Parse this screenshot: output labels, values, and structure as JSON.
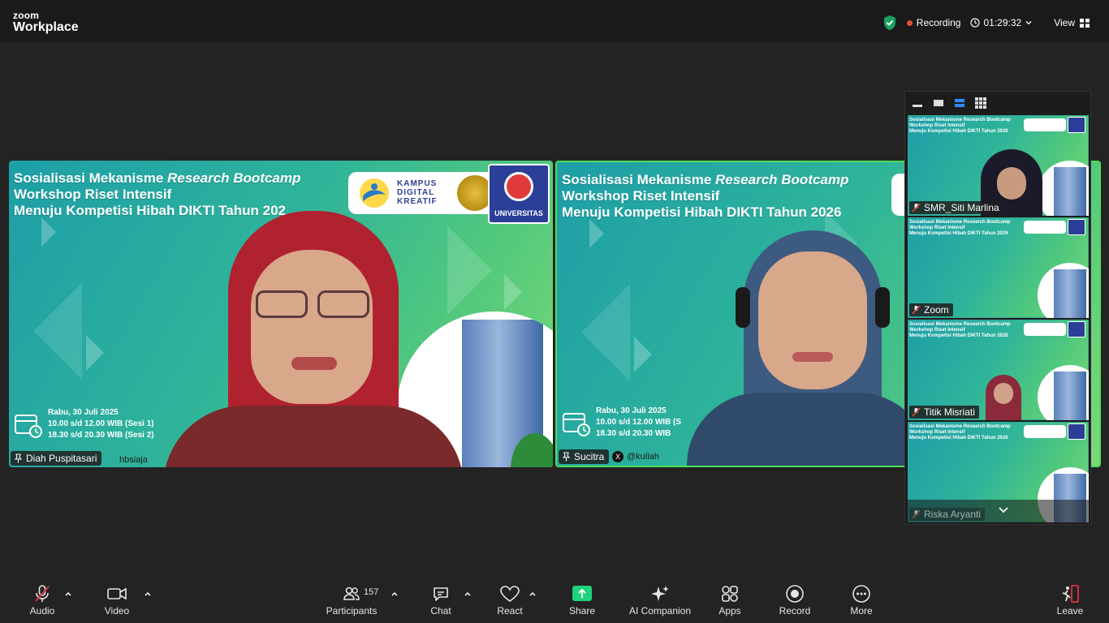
{
  "app": {
    "brand_top": "zoom",
    "brand_bottom": "Workplace"
  },
  "header": {
    "recording_label": "Recording",
    "timer": "01:29:32",
    "view_label": "View"
  },
  "slide": {
    "title_line1_a": "Sosialisasi Mekanisme ",
    "title_line1_b": "Research Bootcamp",
    "title_line2": "Workshop Riset Intensif",
    "title_line3_a": "Menuju Kompetisi Hibah DIKTI Tahun 202",
    "title_line3_b": "Menuju Kompetisi Hibah DIKTI Tahun 2026",
    "date": "Rabu, 30 Juli 2025",
    "sesi1": "10.00 s/d 12.00 WIB (Sesi 1)",
    "sesi2": "18.30 s/d 20.30 WIB (Sesi 2)",
    "sesi1_cut": "10.00 s/d 12.00 WIB (S",
    "sesi2_cut": "18.30 s/d 20.30 WIB",
    "logo_text1": "KAMPUS",
    "logo_text2": "DIGITAL",
    "logo_text3": "KREATIF",
    "univ": "UNIVERSITAS",
    "handle_a": "hbsiaja",
    "handle_b": "@kuliah"
  },
  "tiles": [
    {
      "name": "Diah Puspitasari"
    },
    {
      "name": "Sucitra"
    }
  ],
  "gallery": {
    "thumb_title1": "Sosialisasi Mekanisme Research Bootcamp",
    "thumb_title2": "Workshop Riset Intensif",
    "thumb_title3": "Menuju Kompetisi Hibah DIKTI Tahun 2026",
    "participants": [
      {
        "name": "SMR_Siti Marlina"
      },
      {
        "name": "Zoom"
      },
      {
        "name": "Titik Misriati"
      },
      {
        "name": "Riska Aryanti"
      }
    ]
  },
  "toolbar": {
    "audio": "Audio",
    "video": "Video",
    "participants": "Participants",
    "participant_count": "157",
    "chat": "Chat",
    "react": "React",
    "share": "Share",
    "ai": "AI Companion",
    "apps": "Apps",
    "record": "Record",
    "more": "More",
    "leave": "Leave"
  },
  "colors": {
    "active_speaker": "#4ddf5a",
    "share_green": "#1fd27c",
    "recording_red": "#e74c3c",
    "shield_green": "#1aa260"
  }
}
